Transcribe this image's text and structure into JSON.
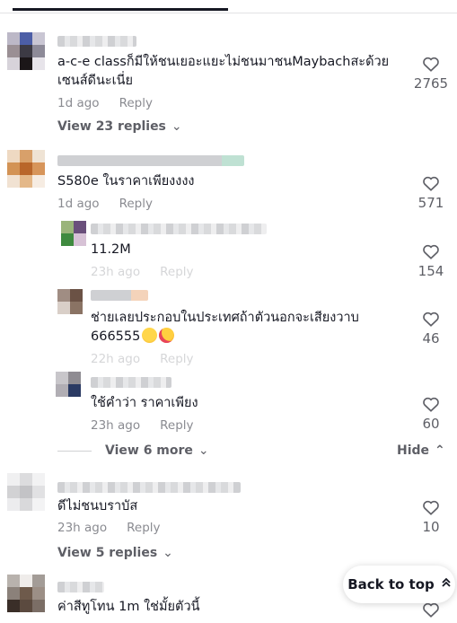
{
  "icons": {
    "heart": "heart-outline-icon",
    "chevron_down": "chevron-down-icon",
    "chevron_up": "chevron-up-icon",
    "back_to_top": "double-chevron-up-icon"
  },
  "comments": [
    {
      "text": "a-c-e classก็มีให้ชนเยอะแยะไม่ชนมาชนMaybachสะด้วย\nเซนส์ดีนะเนี่ย",
      "time": "1d ago",
      "reply": "Reply",
      "likes": "2765",
      "view_replies": "View 23 replies"
    },
    {
      "text": "S580e ในราคาเพียงงงง",
      "time": "1d ago",
      "reply": "Reply",
      "likes": "571",
      "replies": [
        {
          "text": "11.2M",
          "time": "23h ago",
          "reply": "Reply",
          "likes": "154"
        },
        {
          "text": "ช่ายเลยประกอบในประเทศถ้าตัวนอกจะเสียงวาบ\n666555",
          "time": "22h ago",
          "reply": "Reply",
          "likes": "46",
          "emojis": [
            "grinning-squinting-face",
            "smiling-face-with-hearts"
          ]
        },
        {
          "text": "ใช้คำว่า ราคาเพียง",
          "time": "23h ago",
          "reply": "Reply",
          "likes": "60"
        }
      ],
      "view_more": "View 6 more",
      "hide": "Hide"
    },
    {
      "text": "ดีไม่ชนบราบัส",
      "time": "23h ago",
      "reply": "Reply",
      "likes": "10",
      "view_replies": "View 5 replies"
    },
    {
      "text": "ค่าสีทูโทน 1m ใช่มั้ยตัวนี้",
      "likes": ""
    }
  ],
  "back_to_top": "Back to top",
  "colors": {
    "text": "#161823",
    "secondary": "#8a8b91",
    "bold_secondary": "#5e5f66"
  }
}
